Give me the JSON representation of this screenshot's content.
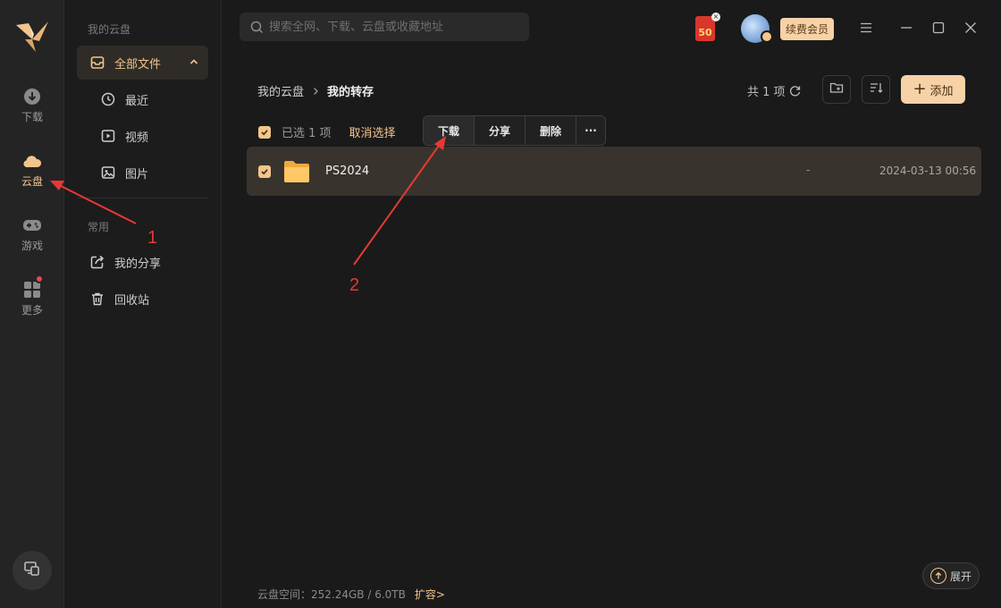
{
  "rail": {
    "items": [
      {
        "label": "下载",
        "icon": "download-icon"
      },
      {
        "label": "云盘",
        "icon": "cloud-icon",
        "active": true
      },
      {
        "label": "游戏",
        "icon": "gamepad-icon"
      },
      {
        "label": "更多",
        "icon": "grid-icon"
      }
    ]
  },
  "sidebar": {
    "section_title": "我的云盘",
    "items": [
      {
        "label": "全部文件",
        "icon": "inbox-icon",
        "active": true
      },
      {
        "label": "最近",
        "icon": "clock-icon"
      },
      {
        "label": "视频",
        "icon": "video-icon"
      },
      {
        "label": "图片",
        "icon": "image-icon"
      }
    ],
    "common_title": "常用",
    "common_items": [
      {
        "label": "我的分享",
        "icon": "share-icon"
      },
      {
        "label": "回收站",
        "icon": "trash-icon"
      }
    ]
  },
  "topbar": {
    "search_placeholder": "搜索全网、下载、云盘或收藏地址",
    "redpack_value": "50",
    "vip_label": "续费会员"
  },
  "breadcrumb": {
    "root": "我的云盘",
    "current": "我的转存"
  },
  "toolbar": {
    "count_label": "共 1 项",
    "add_label": "添加"
  },
  "selection": {
    "selected_text": "已选 1 项",
    "cancel_label": "取消选择",
    "actions": [
      "下载",
      "分享",
      "删除",
      "···"
    ]
  },
  "files": [
    {
      "name": "PS2024",
      "size": "-",
      "date": "2024-03-13 00:56",
      "selected": true,
      "type": "folder"
    }
  ],
  "footer": {
    "storage_text": "云盘空间：252.24GB / 6.0TB",
    "expand_link": "扩容>",
    "expand_button": "展开"
  },
  "annotations": {
    "label_1": "1",
    "label_2": "2",
    "color": "#e53935"
  },
  "colors": {
    "accent": "#f3c58c",
    "background": "#1a1a1b",
    "row_selected": "#38342d"
  }
}
